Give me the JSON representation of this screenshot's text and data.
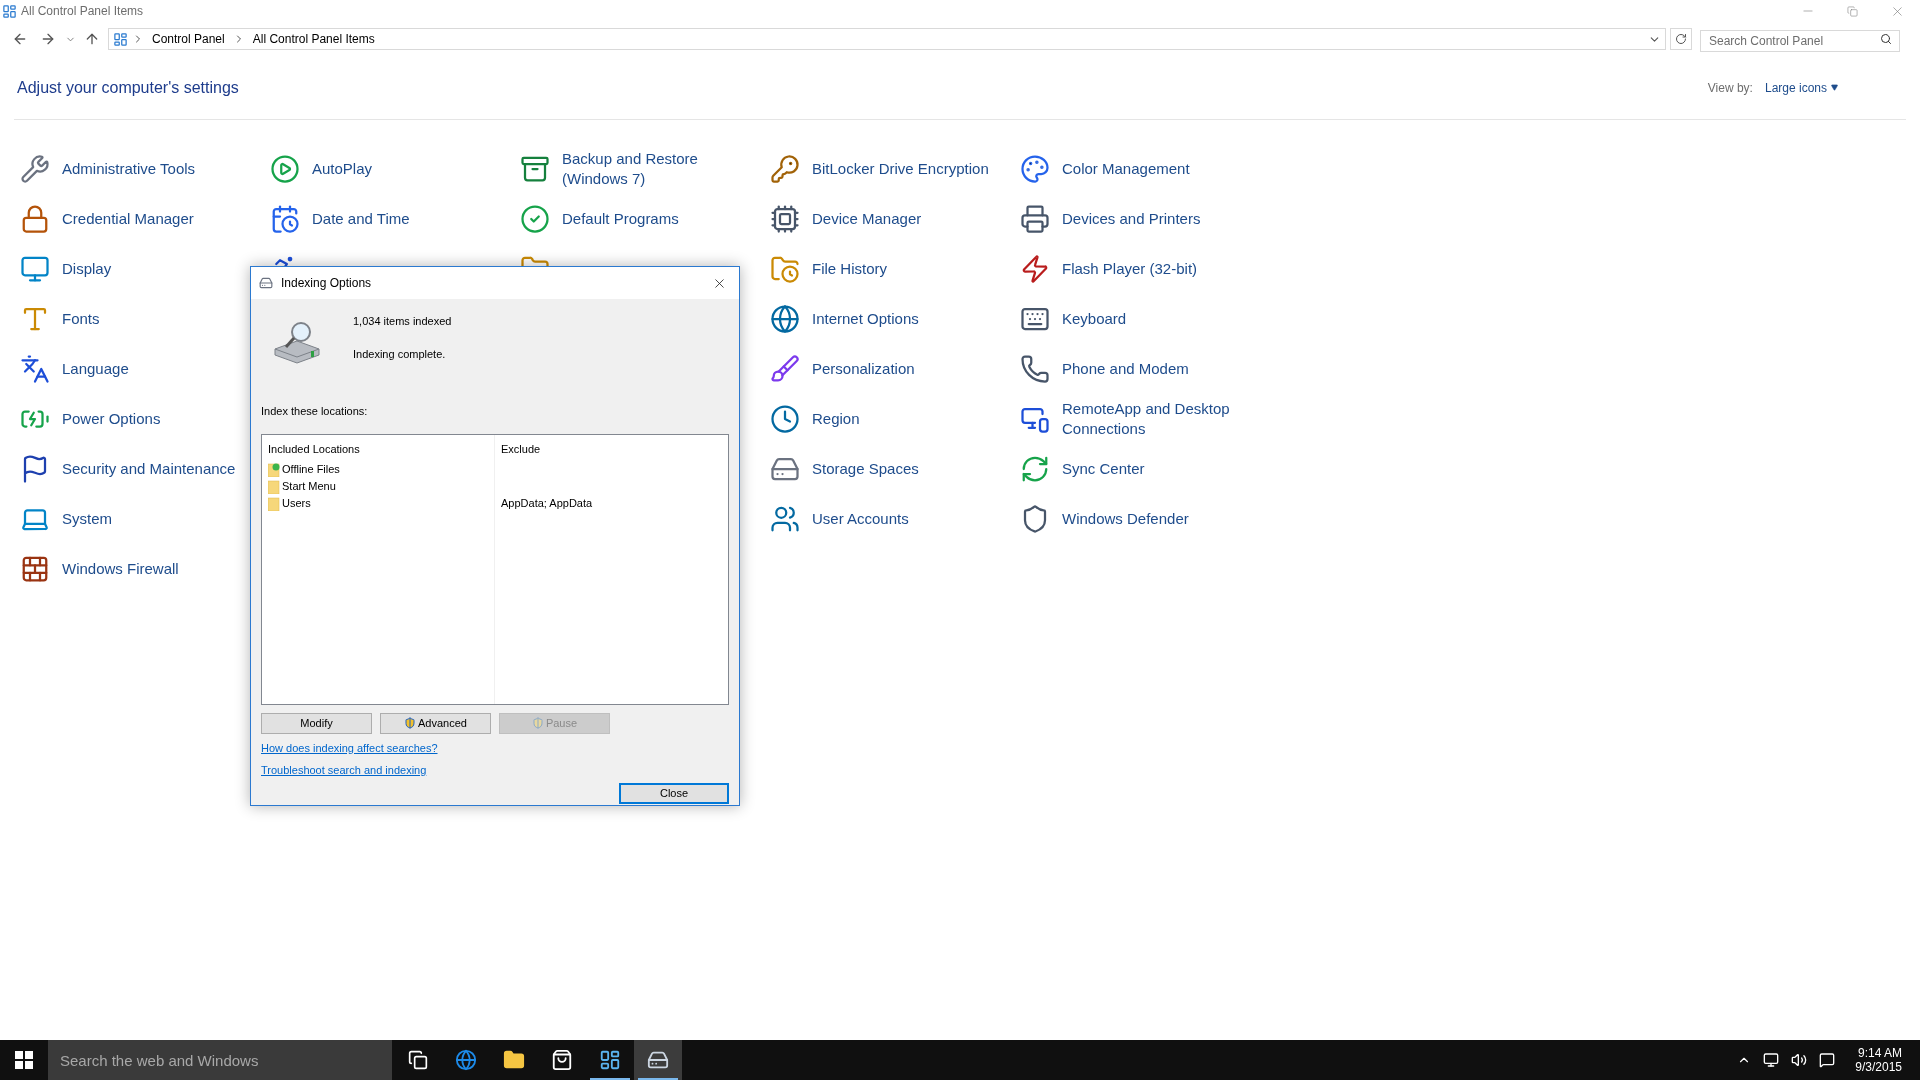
{
  "window": {
    "title": "All Control Panel Items"
  },
  "address_bar": {
    "breadcrumbs": [
      "Control Panel",
      "All Control Panel Items"
    ]
  },
  "search": {
    "placeholder": "Search Control Panel"
  },
  "heading": "Adjust your computer's settings",
  "view_by": {
    "label": "View by:",
    "value": "Large icons"
  },
  "item_rows": [
    [
      {
        "kind": "item",
        "label": "Administrative Tools"
      },
      {
        "kind": "item",
        "label": "AutoPlay"
      },
      {
        "kind": "item",
        "label": "Backup and Restore (Windows 7)"
      },
      {
        "kind": "item",
        "label": "BitLocker Drive Encryption"
      },
      {
        "kind": "item",
        "label": "Color Management"
      }
    ],
    [
      {
        "kind": "item",
        "label": "Credential Manager"
      },
      {
        "kind": "item",
        "label": "Date and Time"
      },
      {
        "kind": "item",
        "label": "Default Programs"
      },
      {
        "kind": "item",
        "label": "Device Manager"
      },
      {
        "kind": "item",
        "label": "Devices and Printers"
      }
    ],
    [
      {
        "kind": "item",
        "label": "Display"
      },
      {
        "kind": "covered"
      },
      {
        "kind": "covered"
      },
      {
        "kind": "item",
        "label": "File History"
      },
      {
        "kind": "item",
        "label": "Flash Player (32-bit)"
      }
    ],
    [
      {
        "kind": "item",
        "label": "Fonts"
      },
      {
        "kind": "empty"
      },
      {
        "kind": "empty"
      },
      {
        "kind": "item",
        "label": "Internet Options"
      },
      {
        "kind": "item",
        "label": "Keyboard"
      }
    ],
    [
      {
        "kind": "item",
        "label": "Language"
      },
      {
        "kind": "empty"
      },
      {
        "kind": "empty"
      },
      {
        "kind": "item",
        "label": "Personalization"
      },
      {
        "kind": "item",
        "label": "Phone and Modem"
      }
    ],
    [
      {
        "kind": "item",
        "label": "Power Options"
      },
      {
        "kind": "empty"
      },
      {
        "kind": "empty"
      },
      {
        "kind": "item",
        "label": "Region"
      },
      {
        "kind": "item",
        "label": "RemoteApp and Desktop Connections"
      }
    ],
    [
      {
        "kind": "item",
        "label": "Security and Maintenance"
      },
      {
        "kind": "empty"
      },
      {
        "kind": "empty"
      },
      {
        "kind": "item",
        "label": "Storage Spaces"
      },
      {
        "kind": "item",
        "label": "Sync Center"
      }
    ],
    [
      {
        "kind": "item",
        "label": "System"
      },
      {
        "kind": "empty"
      },
      {
        "kind": "empty"
      },
      {
        "kind": "item",
        "label": "User Accounts"
      },
      {
        "kind": "item",
        "label": "Windows Defender"
      }
    ],
    [
      {
        "kind": "item",
        "label": "Windows Firewall"
      }
    ]
  ],
  "dialog": {
    "title": "Indexing Options",
    "count": "1,034 items indexed",
    "status": "Indexing complete.",
    "locations_label": "Index these locations:",
    "columns": [
      "Included Locations",
      "Exclude"
    ],
    "rows": [
      {
        "kind": "offline",
        "location": "Offline Files"
      },
      {
        "kind": "folder",
        "location": "Start Menu"
      },
      {
        "kind": "folder",
        "location": "Users",
        "exclude": "AppData; AppData"
      }
    ],
    "buttons": [
      {
        "label": "Modify",
        "shield": false,
        "disabled": false
      },
      {
        "label": "Advanced",
        "shield": true,
        "disabled": false
      },
      {
        "label": "Pause",
        "shield": true,
        "disabled": true
      }
    ],
    "links": [
      "How does indexing affect searches?",
      "Troubleshoot search and indexing"
    ],
    "close_button": "Close"
  },
  "taskbar": {
    "search_placeholder": "Search the web and Windows",
    "apps": [
      {
        "kind": "taskview",
        "open": false,
        "selected": false
      },
      {
        "kind": "browser",
        "open": false,
        "selected": false
      },
      {
        "kind": "explorer",
        "open": false,
        "selected": false
      },
      {
        "kind": "store",
        "open": false,
        "selected": false
      },
      {
        "kind": "controlpanel",
        "open": true,
        "selected": false
      },
      {
        "kind": "indexing",
        "open": true,
        "selected": true
      }
    ],
    "time": "9:14 AM",
    "date": "9/3/2015"
  }
}
